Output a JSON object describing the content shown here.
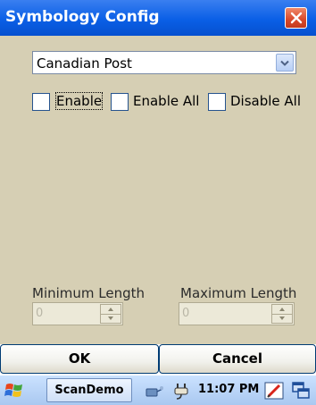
{
  "window": {
    "title": "Symbology Config",
    "close_icon": "close-icon"
  },
  "symbology": {
    "selected": "Canadian Post"
  },
  "checkboxes": {
    "enable": {
      "label": "Enable",
      "checked": false
    },
    "enable_all": {
      "label": "Enable All",
      "checked": false
    },
    "disable_all": {
      "label": "Disable All",
      "checked": false
    }
  },
  "length": {
    "min_label": "Minimum Length",
    "min_value": "0",
    "max_label": "Maximum Length",
    "max_value": "0"
  },
  "buttons": {
    "ok": "OK",
    "cancel": "Cancel"
  },
  "taskbar": {
    "start_icon": "windows-flag-icon",
    "app": "ScanDemo",
    "time": "11:07 PM",
    "tray_icons": [
      "network-icon",
      "usb-plug-icon",
      "pen-input-icon",
      "display-icon"
    ]
  },
  "colors": {
    "titlebar": "#0a5fe6",
    "window_bg": "#d6cfb4",
    "close_button": "#d9482a",
    "taskbar": "#a9c8f0"
  }
}
